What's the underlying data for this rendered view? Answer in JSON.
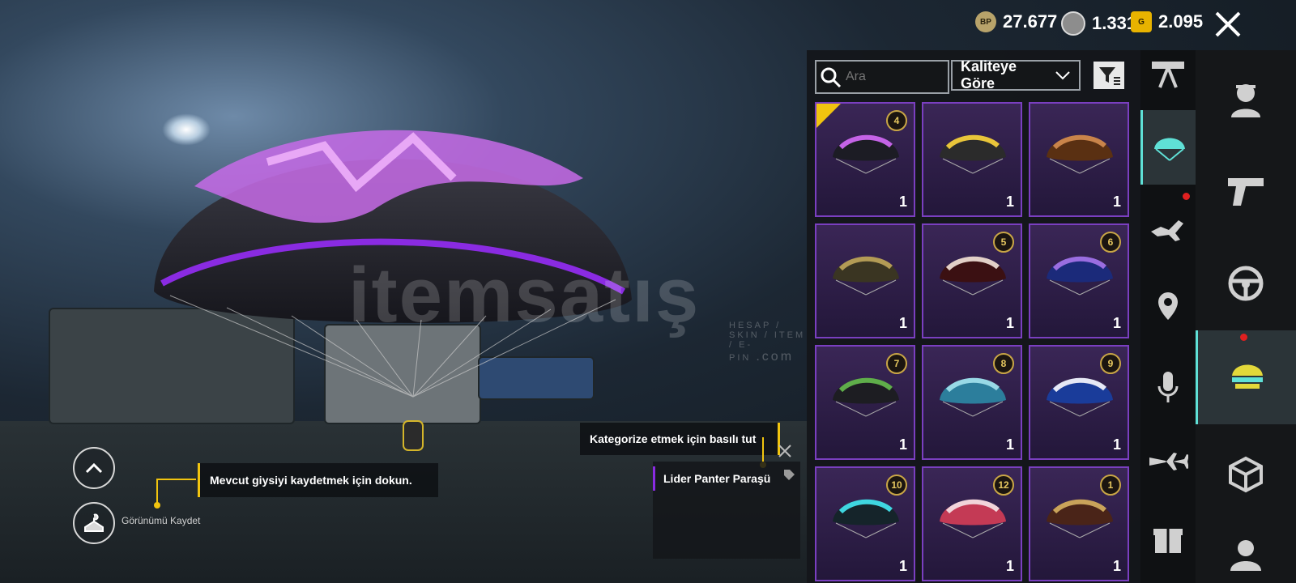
{
  "currency": [
    {
      "icon": "bp-coin-icon",
      "label": "BP",
      "value": "27.677",
      "color": "#b8a36a"
    },
    {
      "icon": "silver-coin-icon",
      "label": "",
      "value": "1.331",
      "color": "#b9b9b9"
    },
    {
      "icon": "g-coin-icon",
      "label": "G",
      "value": "2.095",
      "color": "#e8b300"
    }
  ],
  "watermark": {
    "main": "itemsatış",
    "sub": "HESAP / SKIN / ITEM / E-PIN",
    "suffix": ".com"
  },
  "search": {
    "placeholder": "Ara"
  },
  "sort": {
    "label": "Kaliteye Göre"
  },
  "tooltips": {
    "categorize": "Kategorize etmek için basılı tut",
    "save_outfit": "Mevcut giysiyi kaydetmek için dokun.",
    "item_name": "Lider Panter Paraşü"
  },
  "save_look": {
    "label": "Görünümü Kaydet"
  },
  "items": [
    {
      "level": "4",
      "qty": "1",
      "equipped": true,
      "c1": "#1c1c24",
      "c2": "#c463e6"
    },
    {
      "level": "",
      "qty": "1",
      "equipped": false,
      "c1": "#2b2b2b",
      "c2": "#e8c53a"
    },
    {
      "level": "",
      "qty": "1",
      "equipped": false,
      "c1": "#5a3012",
      "c2": "#c9844a"
    },
    {
      "level": "",
      "qty": "1",
      "equipped": false,
      "c1": "#3a3522",
      "c2": "#b39b55"
    },
    {
      "level": "5",
      "qty": "1",
      "equipped": false,
      "c1": "#3b1012",
      "c2": "#e2d0c8"
    },
    {
      "level": "6",
      "qty": "1",
      "equipped": false,
      "c1": "#1b2a7a",
      "c2": "#9a6de0"
    },
    {
      "level": "7",
      "qty": "1",
      "equipped": false,
      "c1": "#1d1d22",
      "c2": "#5fae4a"
    },
    {
      "level": "8",
      "qty": "1",
      "equipped": false,
      "c1": "#2c7e9c",
      "c2": "#98d9e6"
    },
    {
      "level": "9",
      "qty": "1",
      "equipped": false,
      "c1": "#1a3c9a",
      "c2": "#e6e8f5"
    },
    {
      "level": "10",
      "qty": "1",
      "equipped": false,
      "c1": "#15242a",
      "c2": "#3fd6e0"
    },
    {
      "level": "12",
      "qty": "1",
      "equipped": false,
      "c1": "#c43a55",
      "c2": "#f1d4da"
    },
    {
      "level": "1",
      "qty": "1",
      "equipped": false,
      "c1": "#4a2418",
      "c2": "#c9a35a"
    }
  ]
}
